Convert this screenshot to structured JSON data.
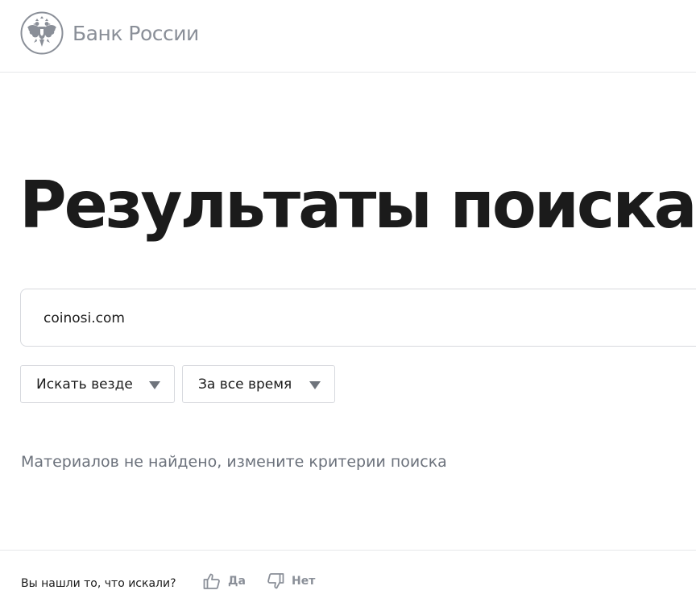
{
  "header": {
    "logo_text": "Банк России",
    "emblem_icon": "double-headed-eagle-icon"
  },
  "main": {
    "title": "Результаты поиска",
    "search": {
      "value": "coinosi.com",
      "placeholder": ""
    },
    "filters": {
      "where": {
        "selected": "Искать везде",
        "icon": "triangle-down-icon"
      },
      "when": {
        "selected": "За все время",
        "icon": "triangle-down-icon"
      }
    },
    "empty_message": "Материалов не найдено, измените критерии поиска"
  },
  "feedback": {
    "question": "Вы нашли то, что искали?",
    "yes_label": "Да",
    "yes_icon": "thumbs-up-icon",
    "no_label": "Нет",
    "no_icon": "thumbs-down-icon"
  },
  "colors": {
    "text": "#1b1b1b",
    "muted": "#6c727c",
    "logo_gray": "#8a8f98",
    "border": "#d7d9de",
    "divider": "#e6e7ea"
  }
}
